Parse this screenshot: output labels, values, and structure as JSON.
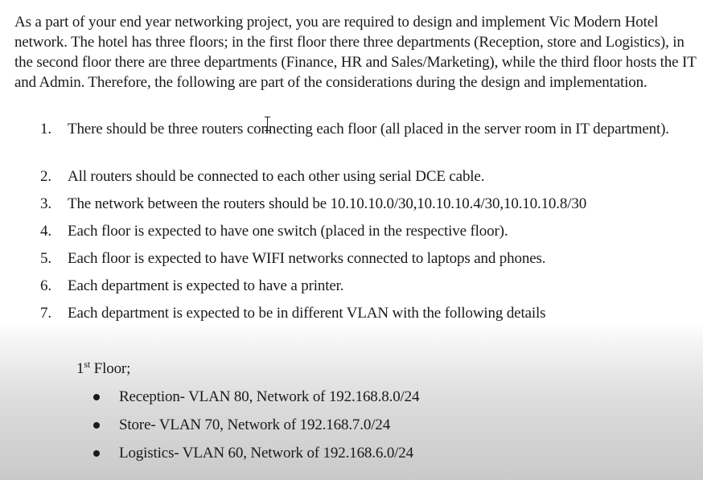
{
  "document": {
    "intro": "As a part of your end year networking project, you are required to design and implement Vic Modern Hotel network. The hotel has three floors; in the first floor there three departments (Reception, store and Logistics), in the second floor there are three departments (Finance, HR and Sales/Marketing), while the third floor hosts the IT and Admin. Therefore, the following are part of the considerations during the design and implementation.",
    "requirements": [
      {
        "number": "1.",
        "text": "There should be three routers connecting each floor (all placed in the server room in IT department)."
      },
      {
        "number": "2.",
        "text": "All routers should be connected to each other using serial DCE cable."
      },
      {
        "number": "3.",
        "text": "The network between the routers should be 10.10.10.0/30,10.10.10.4/30,10.10.10.8/30"
      },
      {
        "number": "4.",
        "text": "Each floor is expected to have one switch (placed in the respective floor)."
      },
      {
        "number": "5.",
        "text": "Each floor is expected to have WIFI networks connected to laptops and phones."
      },
      {
        "number": "6.",
        "text": "Each department is expected to have a printer."
      },
      {
        "number": "7.",
        "text": "Each department is expected to be in different VLAN with the following details"
      }
    ],
    "floor_1": {
      "ordinal": "1",
      "suffix": "st",
      "label": " Floor;",
      "departments": [
        "Reception- VLAN 80, Network of 192.168.8.0/24",
        "Store- VLAN 70, Network of 192.168.7.0/24",
        "Logistics- VLAN 60, Network of 192.168.6.0/24"
      ]
    }
  },
  "cursor": {
    "icon": "text-cursor-icon"
  }
}
